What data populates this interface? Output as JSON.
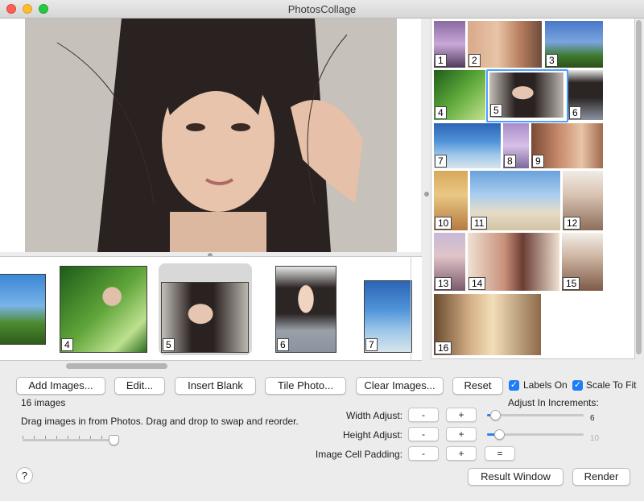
{
  "window": {
    "title": "PhotosCollage"
  },
  "strip": {
    "items": [
      {
        "label": "4"
      },
      {
        "label": "5"
      },
      {
        "label": "6"
      },
      {
        "label": "7"
      }
    ]
  },
  "grid": {
    "items": [
      {
        "label": "1"
      },
      {
        "label": "2"
      },
      {
        "label": "3"
      },
      {
        "label": "4"
      },
      {
        "label": "5"
      },
      {
        "label": "6"
      },
      {
        "label": "7"
      },
      {
        "label": "8"
      },
      {
        "label": "9"
      },
      {
        "label": "10"
      },
      {
        "label": "11"
      },
      {
        "label": "12"
      },
      {
        "label": "13"
      },
      {
        "label": "14"
      },
      {
        "label": "15"
      },
      {
        "label": "16"
      }
    ],
    "selected": "5"
  },
  "toolbar": {
    "add_images": "Add Images...",
    "edit": "Edit...",
    "insert_blank": "Insert Blank",
    "tile_photo": "Tile Photo...",
    "clear_images": "Clear Images...",
    "reset": "Reset",
    "labels_on": "Labels On",
    "scale_to_fit": "Scale To Fit"
  },
  "info": {
    "count": "16 images",
    "hint": "Drag images in from Photos. Drag and drop to swap and reorder."
  },
  "adjust": {
    "increments_title": "Adjust In Increments:",
    "width_label": "Width Adjust:",
    "height_label": "Height Adjust:",
    "padding_label": "Image Cell Padding:",
    "minus": "-",
    "plus": "+",
    "equals": "=",
    "width_value": "6",
    "height_value": "10"
  },
  "footer": {
    "help": "?",
    "result_window": "Result Window",
    "render": "Render"
  },
  "colors": {
    "accent": "#1e7cf6",
    "selection": "#4da0ff"
  }
}
